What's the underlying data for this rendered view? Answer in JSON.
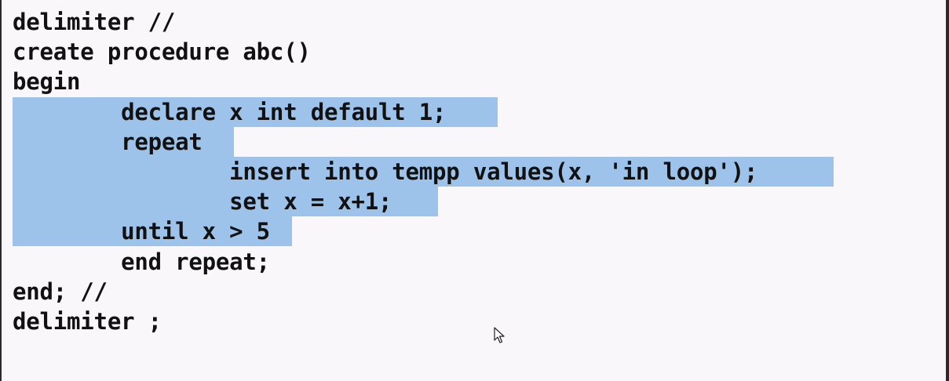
{
  "editor": {
    "lines": [
      "delimiter //",
      "create procedure abc()",
      "begin",
      "        declare x int default 1;",
      "        repeat",
      "                insert into tempp values(x, 'in loop');",
      "                set x = x+1;",
      "        until x > 5",
      "        end repeat;",
      "end; //",
      "delimiter ;"
    ],
    "selection_color": "#9ec3ea",
    "background_color": "#f9f7f9",
    "text_color": "#111111"
  },
  "cursor": {
    "icon": "arrow-pointer-icon"
  }
}
